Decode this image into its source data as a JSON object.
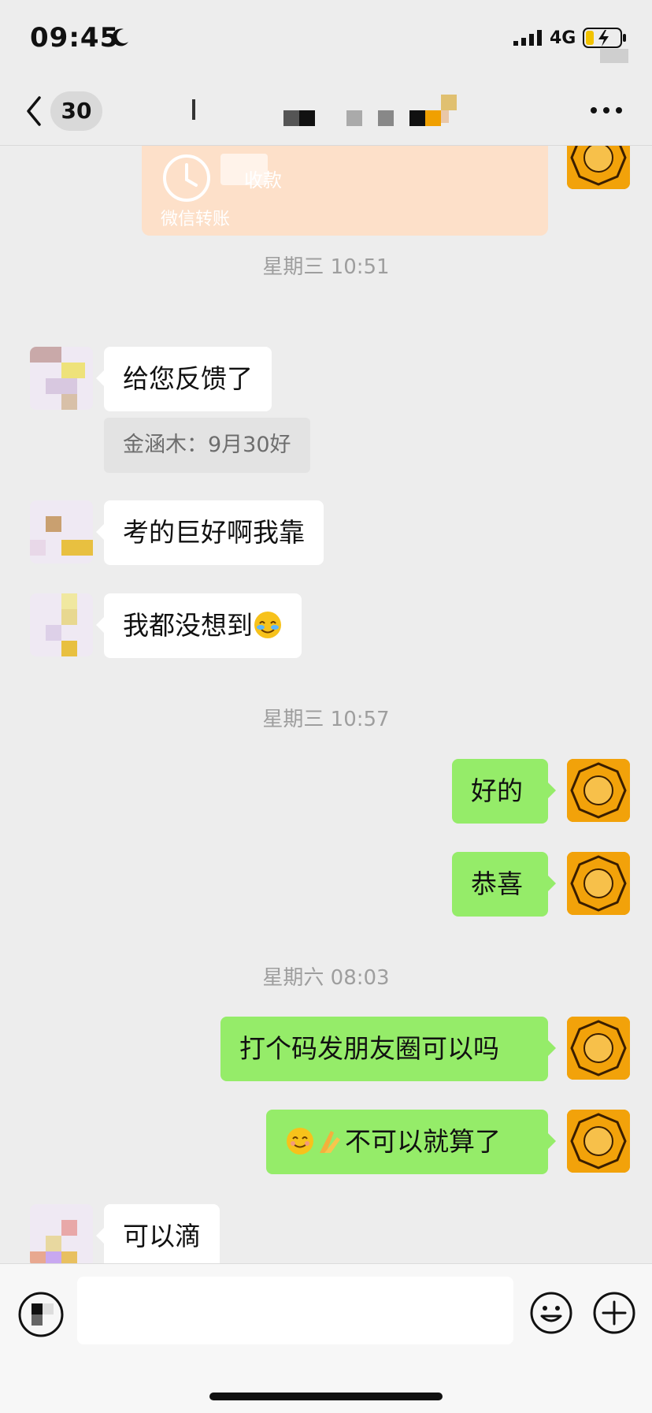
{
  "status_bar": {
    "time": "09:45",
    "network": "4G"
  },
  "header": {
    "unread_count": "30"
  },
  "colors": {
    "accent_green": "#95ec69",
    "background": "#ededed",
    "transfer_orange": "#fde0c9",
    "avatar_gold": "#f2a20a"
  },
  "messages": {
    "transfer": {
      "status": "收款",
      "footer": "微信转账"
    },
    "ts1": "星期三 10:51",
    "m1": "给您反馈了",
    "q1": "金涵木：9月30好",
    "m2": "考的巨好啊我靠",
    "m3": "我都没想到",
    "ts2": "星期三 10:57",
    "m4": "好的",
    "m5": "恭喜",
    "ts3": "星期六 08:03",
    "m6": "打个码发朋友圈可以吗",
    "m7": "不可以就算了",
    "m8": "可以滴"
  },
  "icons": [
    "back-arrow-icon",
    "more-icon",
    "moon-icon",
    "signal-icon",
    "battery-icon",
    "voice-icon",
    "emoji-icon",
    "plus-icon",
    "clock-icon",
    "facepalm-emoji",
    "smile-emoji",
    "pray-emoji"
  ]
}
